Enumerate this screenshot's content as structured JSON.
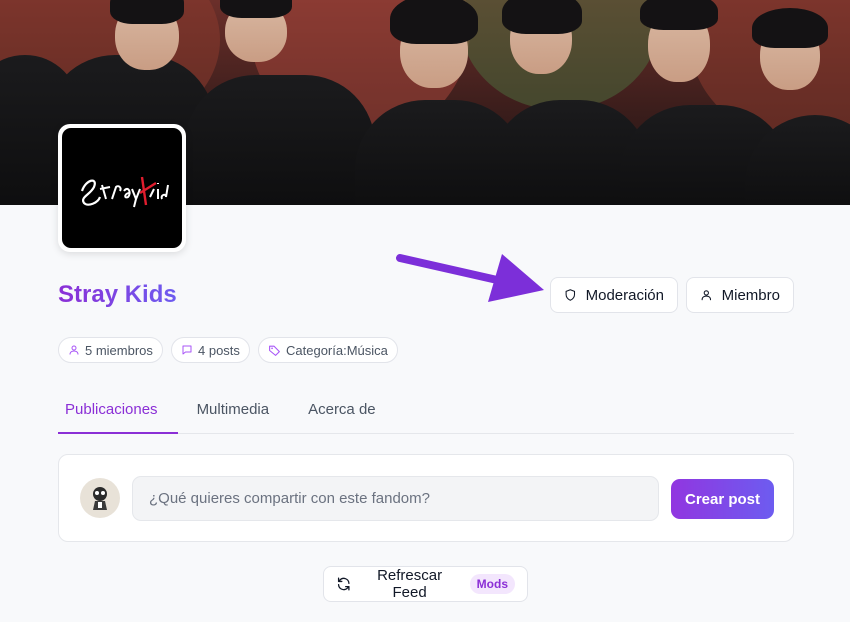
{
  "banner": {
    "alt": "group-photo-banner"
  },
  "community": {
    "name": "Stray Kids",
    "logo_text": "StrayKids"
  },
  "header_buttons": {
    "moderation_label": "Moderación",
    "member_label": "Miembro"
  },
  "stats": {
    "members": "5 miembros",
    "posts": "4 posts",
    "category": "Categoría:Música"
  },
  "tabs": [
    {
      "label": "Publicaciones",
      "active": true
    },
    {
      "label": "Multimedia",
      "active": false
    },
    {
      "label": "Acerca de",
      "active": false
    }
  ],
  "composer": {
    "placeholder": "¿Qué quieres compartir con este fandom?",
    "button_label": "Crear post"
  },
  "refresh": {
    "label": "Refrescar Feed",
    "badge": "Mods"
  },
  "colors": {
    "accent": "#8b2fd6",
    "accent_secondary": "#6d5cf0",
    "arrow": "#7c2fd9"
  }
}
